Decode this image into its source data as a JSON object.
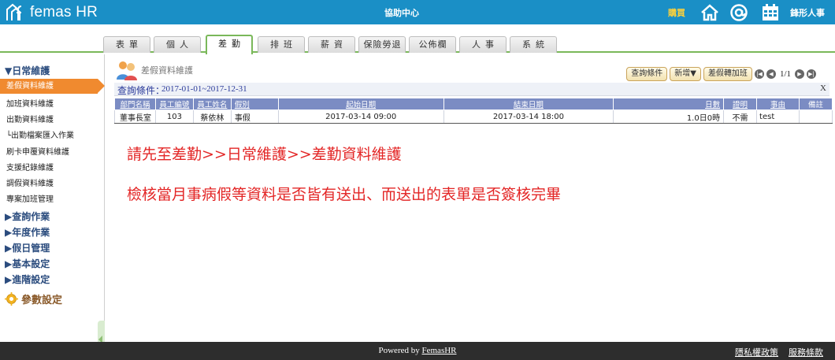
{
  "header": {
    "logo_text": "femas HR",
    "help_center": "協助中心",
    "buy": "購買",
    "company": "鋒形人事",
    "icons": [
      "home-icon",
      "at-icon",
      "calendar-icon"
    ]
  },
  "menu": {
    "tabs": [
      {
        "label": "表單"
      },
      {
        "label": "個人"
      },
      {
        "label": "差勤",
        "active": true
      },
      {
        "label": "排班"
      },
      {
        "label": "薪資"
      },
      {
        "label": "保險勞退"
      },
      {
        "label": "公佈欄"
      },
      {
        "label": "人事"
      },
      {
        "label": "系統"
      }
    ]
  },
  "sidebar": {
    "sections": [
      {
        "label": "▼日常維護"
      },
      {
        "label": "▶查詢作業"
      },
      {
        "label": "▶年度作業"
      },
      {
        "label": "▶假日管理"
      },
      {
        "label": "▶基本設定"
      },
      {
        "label": "▶進階設定"
      }
    ],
    "items": [
      {
        "label": "差假資料維護",
        "active": true
      },
      {
        "label": "加班資料維護"
      },
      {
        "label": "出勤資料維護"
      },
      {
        "label": "└出勤檔案匯入作業"
      },
      {
        "label": "刷卡申覆資料維護"
      },
      {
        "label": "支援紀錄維護"
      },
      {
        "label": "調假資料維護"
      },
      {
        "label": "專案加班管理"
      }
    ],
    "param": "參數設定"
  },
  "content": {
    "title": "差假資料維護",
    "toolbar": {
      "query_btn": "查詢條件",
      "add_btn": "新增▼",
      "convert_btn": "差假轉加班",
      "pager": "1/1"
    },
    "query": {
      "label": "查詢條件：",
      "value": "2017-01-01~2017-12-31",
      "close": "X"
    },
    "table": {
      "columns": [
        "部門名稱",
        "員工編號",
        "員工姓名",
        "假別",
        "起始日期",
        "結束日期",
        "日數",
        "證明",
        "事由",
        "備註"
      ],
      "rows": [
        [
          "董事長室",
          "103",
          "蔡依林",
          "事假",
          "2017-03-14 09:00",
          "2017-03-14 18:00",
          "1.0日0時",
          "不需",
          "test",
          ""
        ]
      ]
    },
    "notice_line1": "請先至差勤>>日常維護>>差勤資料維護",
    "notice_line2": "檢核當月事病假等資料是否皆有送出、而送出的表單是否簽核完畢"
  },
  "footer": {
    "powered_prefix": "Powered by ",
    "powered_link": "FemasHR",
    "privacy": "隱私權政策",
    "terms": "服務條款"
  },
  "colors": {
    "header": "#1a8fc6",
    "accent_green": "#7ab85a",
    "active_orange": "#f08a2f",
    "notice_red": "#e32626",
    "table_header": "#7b8cc3"
  }
}
